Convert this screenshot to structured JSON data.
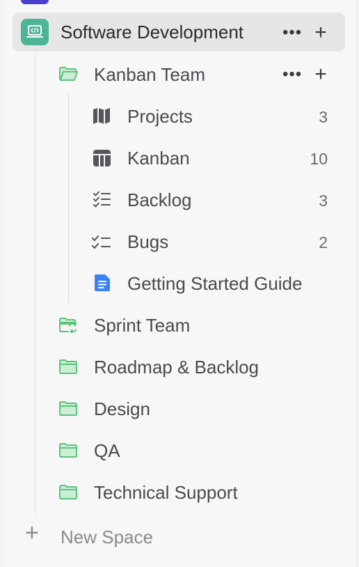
{
  "space": {
    "name": "Software Development",
    "more_label": "•••",
    "add_label": "+",
    "icon": "code-laptop-icon",
    "accent": "#4cb596"
  },
  "kanban_folder": {
    "name": "Kanban Team",
    "more_label": "•••",
    "add_label": "+",
    "items": [
      {
        "label": "Projects",
        "count": "3",
        "icon": "map-icon"
      },
      {
        "label": "Kanban",
        "count": "10",
        "icon": "board-icon"
      },
      {
        "label": "Backlog",
        "count": "3",
        "icon": "checklist-icon"
      },
      {
        "label": "Bugs",
        "count": "2",
        "icon": "checklist-small-icon"
      },
      {
        "label": "Getting Started Guide",
        "count": "",
        "icon": "doc-icon"
      }
    ]
  },
  "folders": [
    {
      "name": "Sprint Team",
      "icon": "sprint-folder-icon"
    },
    {
      "name": "Roadmap & Backlog",
      "icon": "folder-icon"
    },
    {
      "name": "Design",
      "icon": "folder-icon"
    },
    {
      "name": "QA",
      "icon": "folder-icon"
    },
    {
      "name": "Technical Support",
      "icon": "folder-icon"
    }
  ],
  "new_space": {
    "plus": "+",
    "label": "New Space"
  },
  "colors": {
    "folder_green": "#5cc47a",
    "doc_blue": "#3b82f6",
    "selected_bg": "#e6e6e6"
  }
}
